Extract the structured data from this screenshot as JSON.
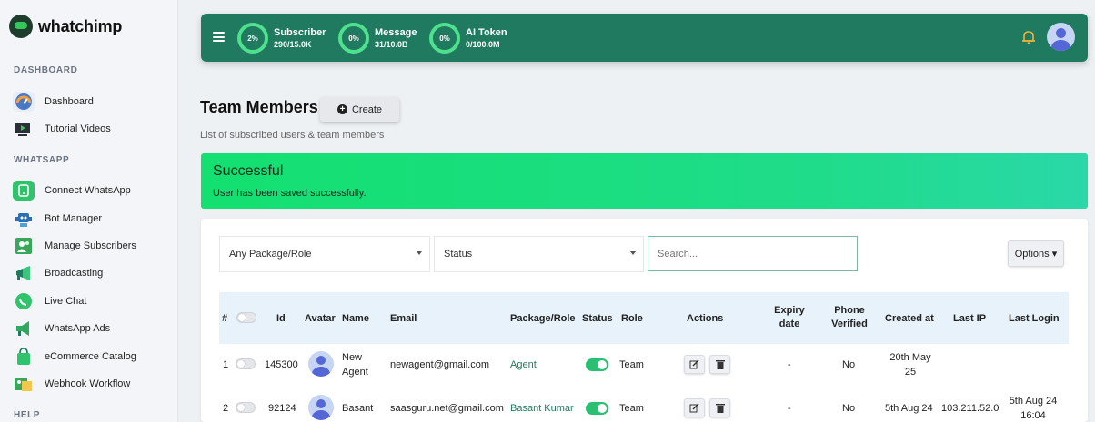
{
  "brand": {
    "name": "whatchimp"
  },
  "sidebar": {
    "sections": [
      {
        "title": "DASHBOARD"
      },
      {
        "title": "WHATSAPP"
      },
      {
        "title": "HELP"
      }
    ],
    "items": [
      {
        "label": "Dashboard",
        "icon": "speedometer-icon"
      },
      {
        "label": "Tutorial Videos",
        "icon": "video-icon"
      },
      {
        "label": "Connect WhatsApp",
        "icon": "whatsapp-icon"
      },
      {
        "label": "Bot Manager",
        "icon": "bot-icon"
      },
      {
        "label": "Manage Subscribers",
        "icon": "subscribers-icon"
      },
      {
        "label": "Broadcasting",
        "icon": "broadcast-icon"
      },
      {
        "label": "Live Chat",
        "icon": "chat-icon"
      },
      {
        "label": "WhatsApp Ads",
        "icon": "megaphone-icon"
      },
      {
        "label": "eCommerce Catalog",
        "icon": "shopping-bag-icon"
      },
      {
        "label": "Webhook Workflow",
        "icon": "webhook-icon"
      }
    ]
  },
  "topbar": {
    "stats": [
      {
        "percent": "2%",
        "title": "Subscriber",
        "value": "290/15.0K"
      },
      {
        "percent": "0%",
        "title": "Message",
        "value": "31/10.0B"
      },
      {
        "percent": "0%",
        "title": "AI Token",
        "value": "0/100.0M"
      }
    ],
    "colors": {
      "bar": "#1f7a5f",
      "ring": "#4fe08d"
    }
  },
  "page": {
    "title": "Team Members",
    "create_label": "Create",
    "subtitle": "List of subscribed users & team members"
  },
  "alert": {
    "title": "Successful",
    "message": "User has been saved successfully."
  },
  "filters": {
    "package_role": "Any Package/Role",
    "status": "Status",
    "search_placeholder": "Search...",
    "options_label": "Options ▾"
  },
  "table": {
    "headers": {
      "hash": "#",
      "id": "Id",
      "avatar": "Avatar",
      "name": "Name",
      "email": "Email",
      "package_role": "Package/Role",
      "status": "Status",
      "role": "Role",
      "actions": "Actions",
      "expiry_1": "Expiry",
      "expiry_2": "date",
      "phone_1": "Phone",
      "phone_2": "Verified",
      "created_at": "Created at",
      "last_ip": "Last IP",
      "last_login": "Last Login"
    },
    "rows": [
      {
        "num": "1",
        "id": "145300",
        "name_1": "New",
        "name_2": "Agent",
        "email": "newagent@gmail.com",
        "package": "Agent",
        "status_on": true,
        "role": "Team",
        "expiry": "-",
        "phone_verified": "No",
        "created_1": "20th May",
        "created_2": "25",
        "last_ip": "",
        "last_login_1": "",
        "last_login_2": ""
      },
      {
        "num": "2",
        "id": "92124",
        "name_1": "Basant",
        "name_2": "",
        "email": "saasguru.net@gmail.com",
        "package": "Basant Kumar",
        "status_on": true,
        "role": "Team",
        "expiry": "-",
        "phone_verified": "No",
        "created_1": "5th Aug 24",
        "created_2": "",
        "last_ip": "103.211.52.0",
        "last_login_1": "5th Aug 24",
        "last_login_2": "16:04"
      }
    ]
  }
}
